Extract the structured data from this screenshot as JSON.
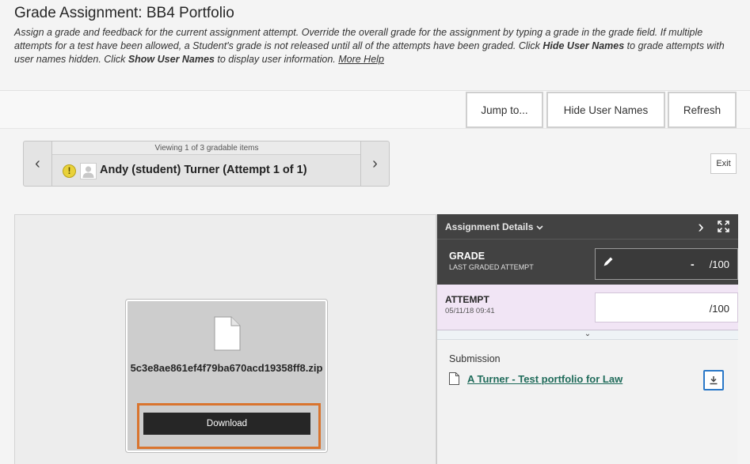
{
  "header": {
    "title": "Grade Assignment: BB4 Portfolio",
    "desc_1": "Assign a grade and feedback for the current assignment attempt. Override the overall grade for the assignment by typing a grade in the grade field. If multiple attempts for a test have been allowed, a Student's grade is not released until all of the attempts have been graded. Click ",
    "desc_bold_1": "Hide User Names",
    "desc_2": " to grade attempts with user names hidden. Click ",
    "desc_bold_2": "Show User Names",
    "desc_3": " to display user information. ",
    "more_help": "More Help"
  },
  "toolbar": {
    "jump_to": "Jump to...",
    "hide_user_names": "Hide User Names",
    "refresh": "Refresh"
  },
  "student_nav": {
    "prev_glyph": "‹",
    "next_glyph": "›",
    "viewing": "Viewing 1 of 3 gradable items",
    "warning_glyph": "!",
    "student_name": "Andy (student) Turner (Attempt 1 of 1)"
  },
  "exit_label": "Exit",
  "viewer": {
    "file_name": "5c3e8ae861ef4f79ba670acd19358ff8.zip",
    "download_label": "Download"
  },
  "details": {
    "title": "Assignment Details",
    "collapse_glyph": "›",
    "grade": {
      "label": "GRADE",
      "sublabel": "LAST GRADED ATTEMPT",
      "value": "-",
      "out_of": "/100"
    },
    "attempt": {
      "label": "ATTEMPT",
      "date": "05/11/18 09:41",
      "out_of": "/100"
    },
    "attempt_chevron": "⌄",
    "submission": {
      "label": "Submission",
      "file_link": "A Turner - Test portfolio for Law"
    }
  },
  "colors": {
    "dark_panel": "#424242",
    "attempt_bg": "#f1e5f5",
    "download_highlight": "#d9742e",
    "link": "#1f6b5a",
    "focus_blue": "#2a78c8"
  },
  "icons": [
    "warning-icon",
    "avatar-icon",
    "chevron-down-icon",
    "collapse-panel-icon",
    "expand-icon",
    "pencil-icon",
    "file-icon",
    "download-icon"
  ]
}
